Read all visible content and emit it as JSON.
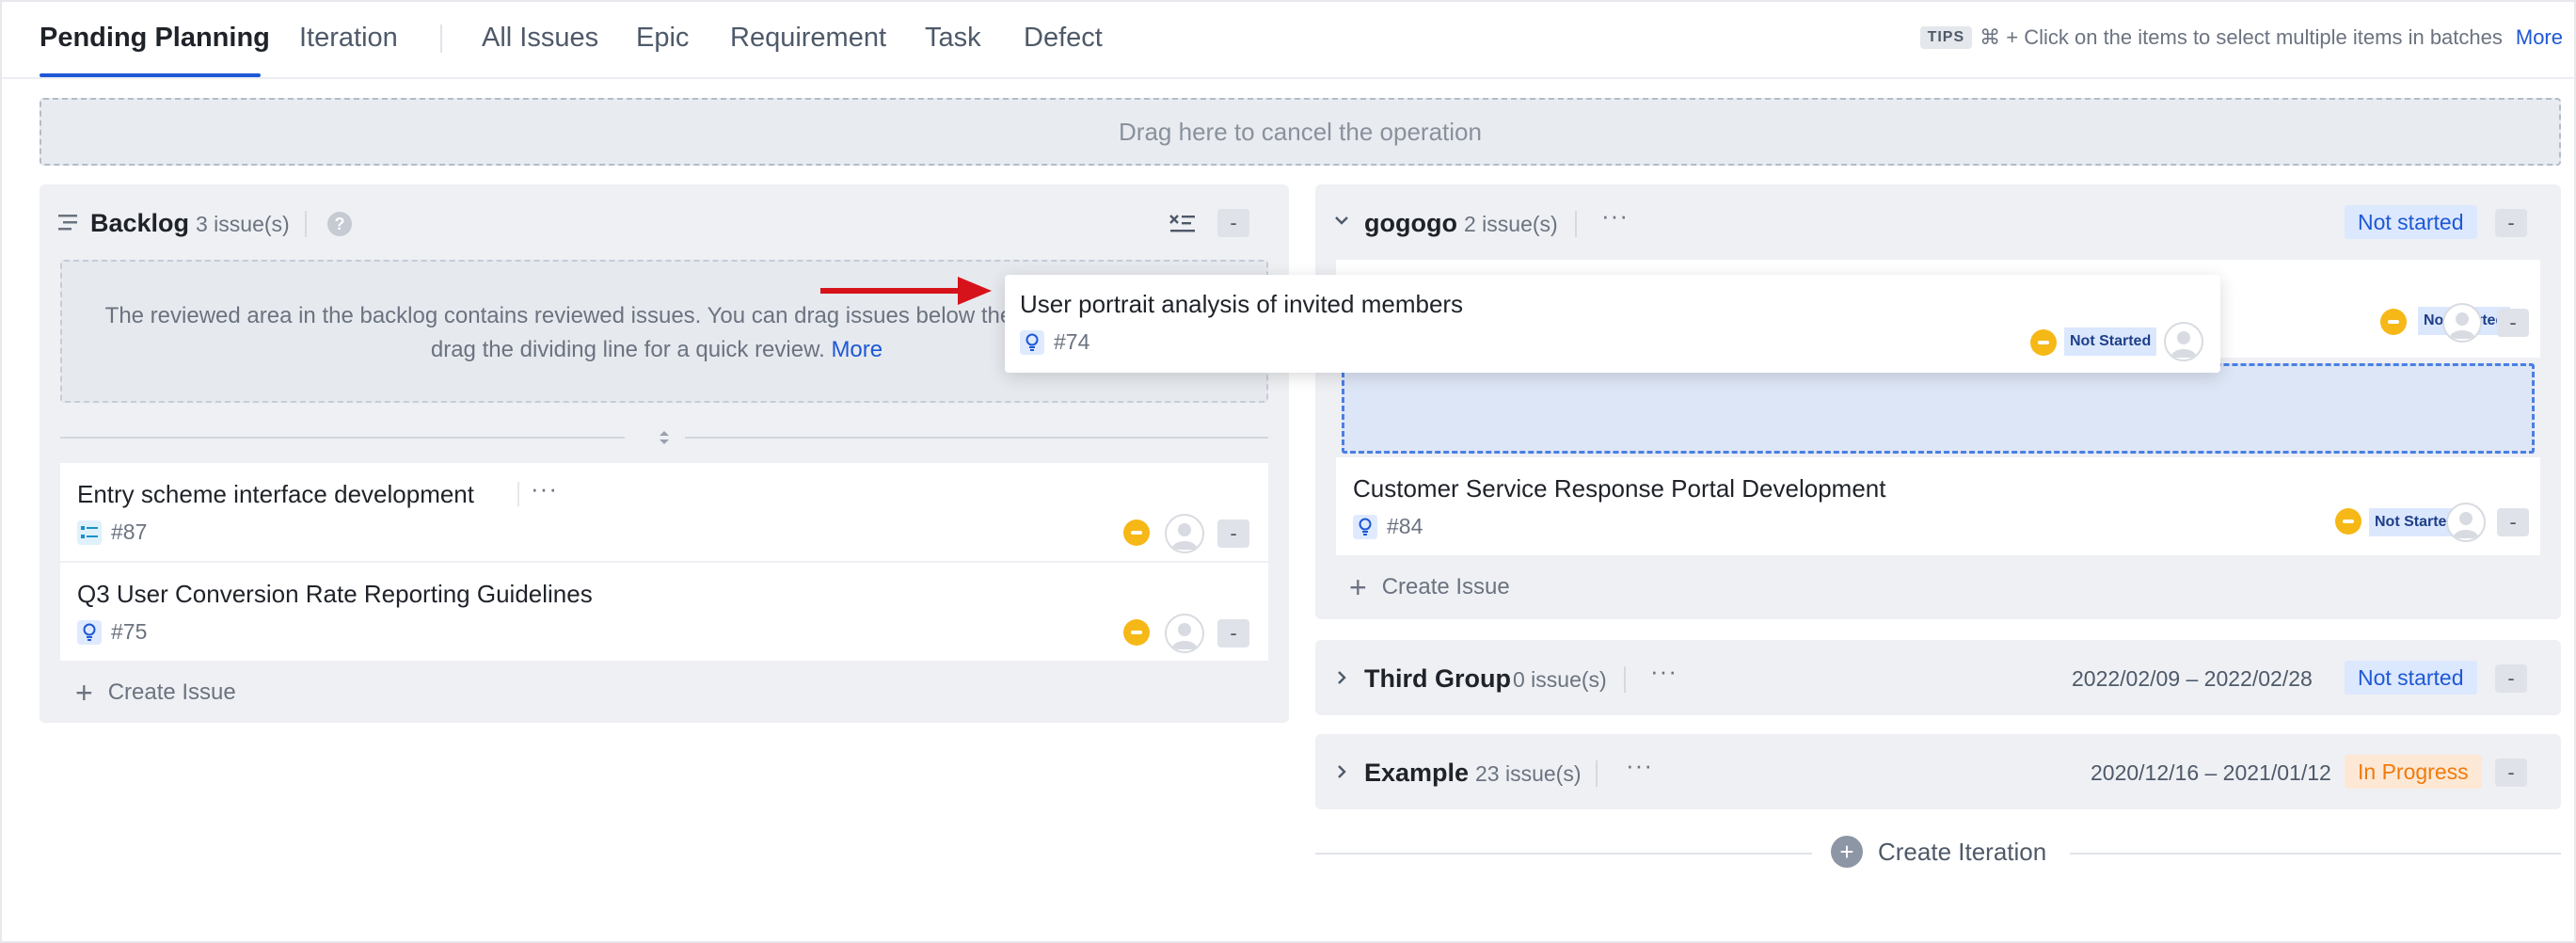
{
  "tabs": {
    "pending_planning": "Pending Planning",
    "iteration": "Iteration",
    "all_issues": "All Issues",
    "epic": "Epic",
    "requirement": "Requirement",
    "task": "Task",
    "defect": "Defect"
  },
  "tips": {
    "tag": "TIPS",
    "text": "⌘ + Click on the items to select multiple items in batches",
    "more": "More"
  },
  "dropzone": {
    "text": "Drag here to cancel the operation"
  },
  "backlog": {
    "title": "Backlog",
    "count": "3 issue(s)",
    "help": "?",
    "collapse": "-",
    "review_text": "The reviewed area in the backlog contains reviewed issues. You can drag issues below the line for a review, or drag the dividing line for a quick review.",
    "review_more": "More",
    "issues": [
      {
        "title": "Entry scheme interface development",
        "id": "#87",
        "action": "-"
      },
      {
        "title": "Q3 User Conversion Rate Reporting Guidelines",
        "id": "#75",
        "action": "-"
      }
    ],
    "create_issue": "Create Issue"
  },
  "drag_ghost": {
    "title": "User portrait analysis of invited members",
    "id": "#74",
    "status": "Not Started"
  },
  "iterations": [
    {
      "name": "gogogo",
      "count": "2 issue(s)",
      "status": "Not started",
      "action": "-",
      "issues": [
        {
          "status": "Not Started",
          "action": "-"
        },
        {
          "title": "Customer Service Response Portal Development",
          "id": "#84",
          "status": "Not Started",
          "action": "-"
        }
      ],
      "create_issue": "Create Issue"
    },
    {
      "name": "Third Group",
      "count": "0 issue(s)",
      "dates": "2022/02/09 – 2022/02/28",
      "status": "Not started",
      "action": "-"
    },
    {
      "name": "Example",
      "count": "23 issue(s)",
      "dates": "2020/12/16 – 2021/01/12",
      "status": "In Progress",
      "action": "-"
    }
  ],
  "create_iteration": "Create Iteration",
  "colors": {
    "accent": "#1e58d6",
    "priority": "#f6b817",
    "not_started_bg": "#dce8fd",
    "in_progress_bg": "#fde8d6",
    "in_progress_text": "#f07a0a",
    "arrow": "#d6131b"
  }
}
